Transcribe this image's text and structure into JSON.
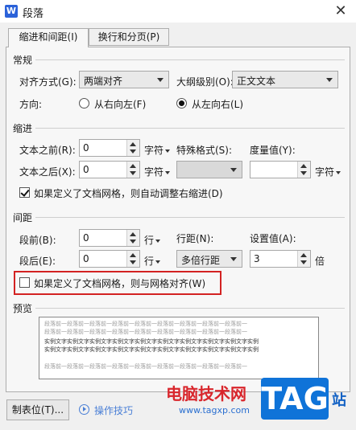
{
  "window": {
    "title": "段落",
    "app_icon_letter": "W",
    "close_glyph": "✕"
  },
  "tabs": [
    {
      "label": "缩进和间距(I)",
      "active": true
    },
    {
      "label": "换行和分页(P)",
      "active": false
    }
  ],
  "general": {
    "title": "常规",
    "alignment_label": "对齐方式(G):",
    "alignment_value": "两端对齐",
    "outline_label": "大纲级别(O):",
    "outline_value": "正文文本",
    "direction_label": "方向:",
    "direction_rtl": "从右向左(F)",
    "direction_ltr": "从左向右(L)",
    "direction_selected": "ltr"
  },
  "indent": {
    "title": "缩进",
    "before_label": "文本之前(R):",
    "before_value": "0",
    "before_unit": "字符",
    "after_label": "文本之后(X):",
    "after_value": "0",
    "after_unit": "字符",
    "special_label": "特殊格式(S):",
    "special_value": "",
    "measure_label": "度量值(Y):",
    "measure_value": "",
    "measure_unit": "字符",
    "auto_adjust_label": "如果定义了文档网格，则自动调整右缩进(D)",
    "auto_adjust_checked": true
  },
  "spacing": {
    "title": "间距",
    "before_label": "段前(B):",
    "before_value": "0",
    "before_unit": "行",
    "after_label": "段后(E):",
    "after_value": "0",
    "after_unit": "行",
    "line_spacing_label": "行距(N):",
    "line_spacing_value": "多倍行距",
    "set_value_label": "设置值(A):",
    "set_value": "3",
    "set_unit": "倍",
    "grid_align_label": "如果定义了文档网格，则与网格对齐(W)",
    "grid_align_checked": false
  },
  "preview": {
    "title": "预览",
    "prev_para_text": "段落前一段落前一段落前一段落前一段落前一段落前一段落前一段落前一段落前一",
    "sample_text": "实例文字实例文字实例文字实例文字实例文字实例文字实例文字实例文字实例文字实例"
  },
  "footer": {
    "tab_stops_button": "制表位(T)...",
    "tips_link": "操作技巧"
  },
  "watermark": {
    "site_name": "电脑技术网",
    "url": "www.tagxp.com",
    "logo_text": "TAG",
    "side_text": "站"
  },
  "colors": {
    "highlight_box": "#d32222",
    "link_blue": "#4a7fd6",
    "watermark_red": "#d9262c",
    "watermark_blue": "#0f73d8"
  }
}
